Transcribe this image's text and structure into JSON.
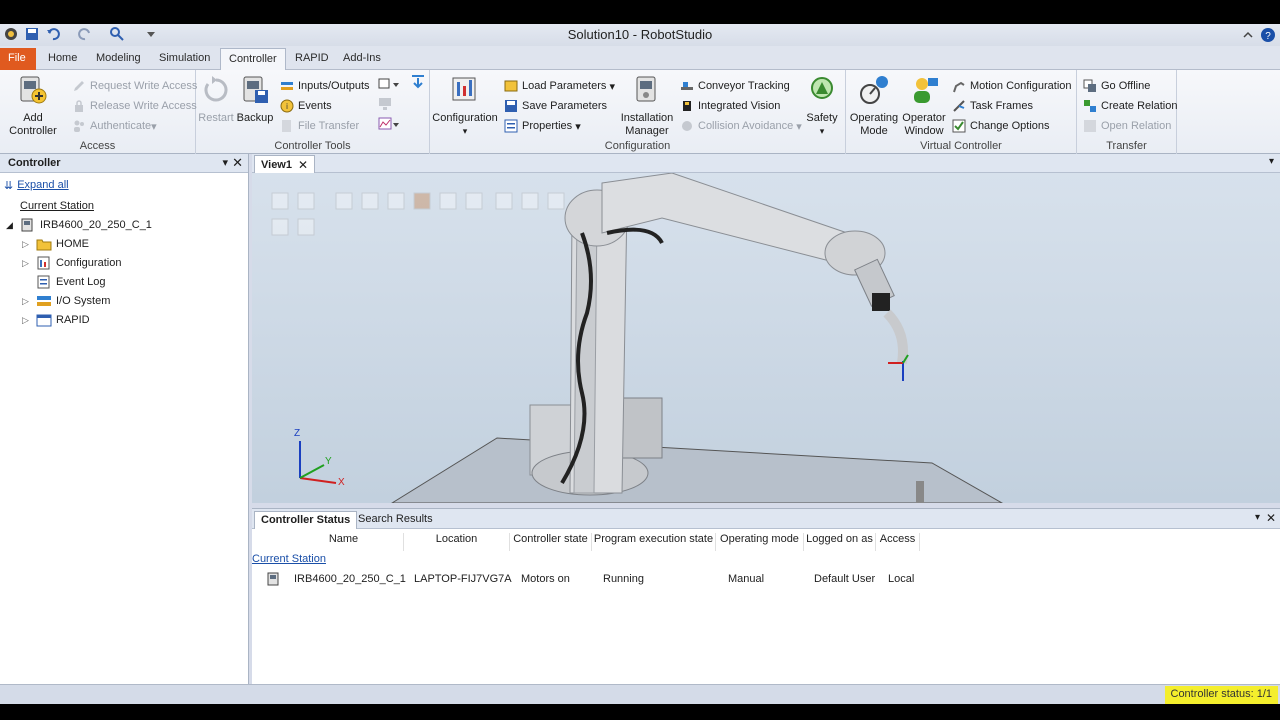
{
  "window": {
    "title": "Solution10 - RobotStudio"
  },
  "ribbon_tabs": [
    "File",
    "Home",
    "Modeling",
    "Simulation",
    "Controller",
    "RAPID",
    "Add-Ins"
  ],
  "ribbon": {
    "access": {
      "label": "Access",
      "add_controller": "Add Controller",
      "request_write": "Request Write Access",
      "release_write": "Release Write Access",
      "authenticate": "Authenticate"
    },
    "controller_tools": {
      "label": "Controller Tools",
      "restart": "Restart",
      "backup": "Backup",
      "io": "Inputs/Outputs",
      "events": "Events",
      "file_transfer": "File Transfer"
    },
    "configuration": {
      "label": "Configuration",
      "configuration": "Configuration",
      "load_params": "Load Parameters",
      "save_params": "Save Parameters",
      "properties": "Properties",
      "installation_manager": "Installation Manager",
      "conveyor_tracking": "Conveyor Tracking",
      "integrated_vision": "Integrated Vision",
      "collision_avoidance": "Collision Avoidance",
      "safety": "Safety"
    },
    "virtual_controller": {
      "label": "Virtual Controller",
      "operating_mode": "Operating Mode",
      "operator_window": "Operator Window",
      "motion_config": "Motion Configuration",
      "task_frames": "Task Frames",
      "change_options": "Change Options"
    },
    "transfer": {
      "label": "Transfer",
      "go_offline": "Go Offline",
      "create_relation": "Create Relation",
      "open_relation": "Open Relation"
    }
  },
  "controller_panel": {
    "title": "Controller",
    "expand_all": "Expand all",
    "current_station": "Current Station",
    "controller_name": "IRB4600_20_250_C_1",
    "items": [
      "HOME",
      "Configuration",
      "Event Log",
      "I/O System",
      "RAPID"
    ]
  },
  "view": {
    "tab": "View1",
    "axis_x": "X",
    "axis_y": "Y",
    "axis_z": "Z"
  },
  "bottom_panel": {
    "tabs": [
      "Controller Status",
      "Search Results"
    ],
    "columns": [
      "Name",
      "Location",
      "Controller state",
      "Program execution state",
      "Operating mode",
      "Logged on as",
      "Access"
    ],
    "group": "Current Station",
    "row": [
      "IRB4600_20_250_C_1",
      "LAPTOP-FIJ7VG7A",
      "Motors on",
      "Running",
      "Manual",
      "Default User",
      "Local"
    ]
  },
  "status_bar": {
    "controller_status": "Controller status: 1/1"
  },
  "colors": {
    "file_tab": "#e05a1f",
    "status_highlight": "#f4ee2c",
    "link": "#1a4fa8"
  }
}
